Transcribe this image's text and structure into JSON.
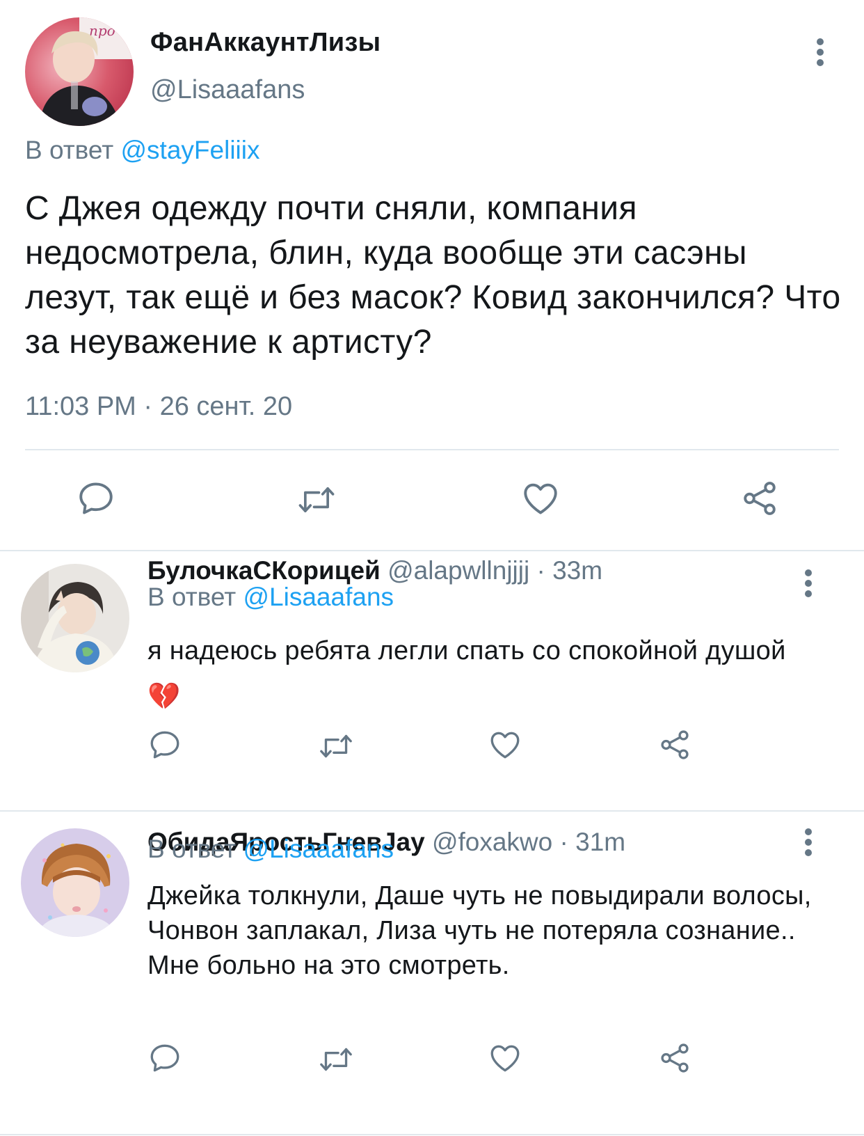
{
  "main_tweet": {
    "display_name": "ФанАккаунтЛизы",
    "handle": "@Lisaaafans",
    "reply_prefix": "В ответ",
    "reply_mention": "@stayFeliiix",
    "text": "С Джея одежду почти сняли, компания недосмотрела, блин, куда вообще эти сасэны лезут, так ещё и без масок? Ковид закончился? Что за неуважение к артисту?",
    "timestamp": "11:03 PM · 26 сент. 20",
    "avatar_sticker_text": "про"
  },
  "replies": [
    {
      "display_name": "БулочкаСКорицей",
      "handle": "@alapwllnjjjj",
      "separator": "·",
      "time": "33m",
      "reply_prefix": "В ответ",
      "reply_mention": "@Lisaaafans",
      "text": "я надеюсь ребята легли спать со спокойной душой💔"
    },
    {
      "display_name": "ОбидаЯростьГневJay",
      "handle": "@foxakwo",
      "separator": "·",
      "time": "31m",
      "reply_prefix": "В ответ",
      "reply_mention": "@Lisaaafans",
      "text": "Джейка толкнули, Даше чуть не повыдирали волосы, Чонвон заплакал, Лиза чуть не потеряла сознание.. Мне больно на это смотреть."
    }
  ],
  "icons": {
    "reply": "speech-bubble-icon",
    "retweet": "retweet-arrows-icon",
    "like": "heart-icon",
    "share": "share-nodes-icon",
    "more": "vertical-dots-icon"
  },
  "colors": {
    "text_primary": "#14171a",
    "text_secondary": "#657786",
    "link": "#1da1f2",
    "divider": "#e1e8ed"
  }
}
